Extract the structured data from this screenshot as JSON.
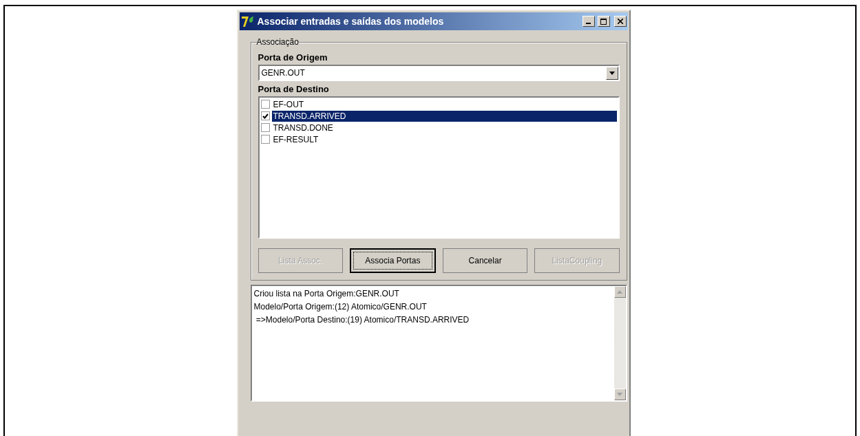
{
  "window": {
    "title": "Associar entradas e saídas dos modelos"
  },
  "group": {
    "title": "Associação",
    "origin": {
      "label": "Porta de Origem",
      "value": "GENR.OUT"
    },
    "destination": {
      "label": "Porta de Destino",
      "items": [
        {
          "label": "EF-OUT",
          "checked": false,
          "selected": false
        },
        {
          "label": "TRANSD.ARRIVED",
          "checked": true,
          "selected": true
        },
        {
          "label": "TRANSD.DONE",
          "checked": false,
          "selected": false
        },
        {
          "label": "EF-RESULT",
          "checked": false,
          "selected": false
        }
      ]
    }
  },
  "buttons": [
    {
      "label": "Lista Assoc.",
      "disabled": true,
      "focused": false
    },
    {
      "label": "Associa Portas",
      "disabled": false,
      "focused": true
    },
    {
      "label": "Cancelar",
      "disabled": false,
      "focused": false
    },
    {
      "label": "ListaCoupling",
      "disabled": true,
      "focused": false
    }
  ],
  "log": [
    "Criou lista na Porta Origem:GENR.OUT",
    "Modelo/Porta Origem:(12) Atomico/GENR.OUT",
    " =>Modelo/Porta Destino:(19) Atomico/TRANSD.ARRIVED"
  ]
}
